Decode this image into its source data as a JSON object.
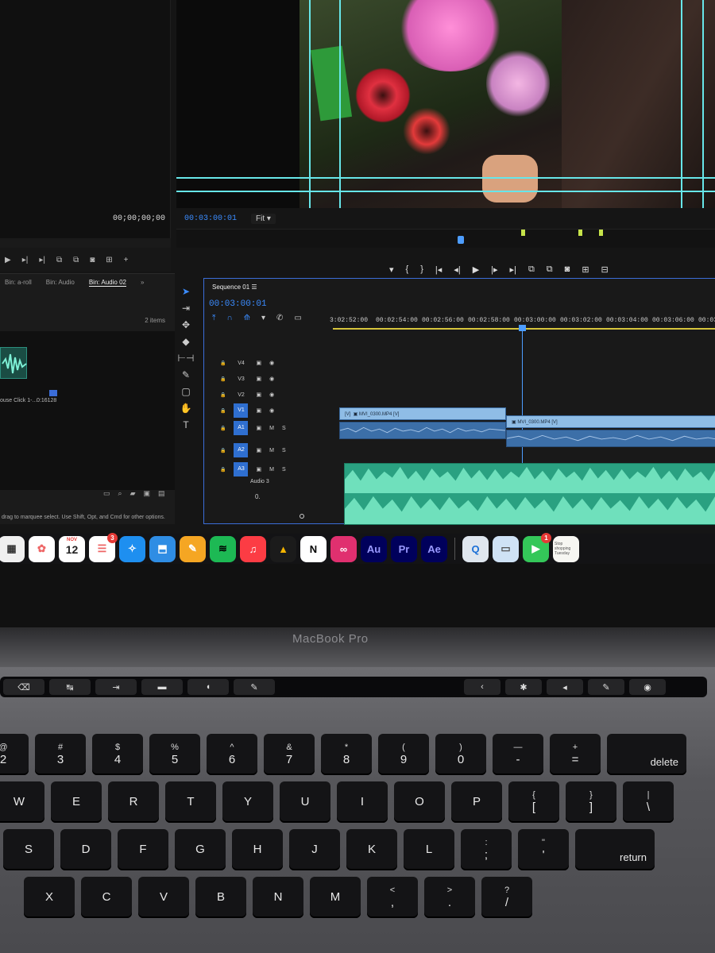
{
  "source_monitor": {
    "timecode": "00;00;00;00"
  },
  "program_monitor": {
    "timecode": "00:03:00:01",
    "fit": "Fit"
  },
  "program_controls": [
    "▾",
    "{",
    "}",
    "|◂",
    "◂|",
    "▶",
    "|▸",
    "▸|",
    "⧉",
    "⧉",
    "◙",
    "⊞",
    "⊟"
  ],
  "project": {
    "tabs": [
      "Bin: a-roll",
      "Bin: Audio",
      "Bin: Audio 02"
    ],
    "items_count": "2 items",
    "clip_name": "ouse Click 1-...",
    "clip_duration": "0:16128"
  },
  "status_text": "drag to marquee select. Use Shift, Opt, and Cmd for other options.",
  "timeline": {
    "tab": "Sequence 01",
    "timecode": "00:03:00:01",
    "ruler": [
      "3:02:52:00",
      "00:02:54:00",
      "00:02:56:00",
      "00:02:58:00",
      "00:03:00:00",
      "00:03:02:00",
      "00:03:04:00",
      "00:03:06:00",
      "00:03:0"
    ],
    "tracks": [
      {
        "label": "V4",
        "on": false
      },
      {
        "label": "V3",
        "on": false
      },
      {
        "label": "V2",
        "on": false
      },
      {
        "label": "V1",
        "on": true
      },
      {
        "label": "A1",
        "on": true,
        "audio": true
      },
      {
        "label": "A2",
        "on": true,
        "audio": true
      },
      {
        "label": "A3",
        "on": true,
        "audio": true
      }
    ],
    "audio3_name": "Audio 3",
    "audio3_level": "0.",
    "clip_fx": "[V]",
    "clip1": "MVI_0300.MP4 [V]",
    "clip2": "MVI_0300.MP4 [V]"
  },
  "dock": {
    "calendar_month": "NOV",
    "calendar_date": "12",
    "reminders_badge": "3",
    "facetime_badge": "1",
    "apps": [
      {
        "name": "Launchpad",
        "text": "▦",
        "bg": "#f0f0f0",
        "fg": "#333"
      },
      {
        "name": "Photos",
        "text": "✿",
        "bg": "#ffffff",
        "fg": "#e66"
      },
      {
        "name": "Calendar",
        "text": "",
        "bg": "#ffffff",
        "fg": "#222"
      },
      {
        "name": "Reminders",
        "text": "☰",
        "bg": "#ffffff",
        "fg": "#e66"
      },
      {
        "name": "Safari",
        "text": "✧",
        "bg": "#1e8ff0",
        "fg": "#fff"
      },
      {
        "name": "Keynote",
        "text": "⬒",
        "bg": "#2f8de4",
        "fg": "#fff"
      },
      {
        "name": "Pages",
        "text": "✎",
        "bg": "#f5a623",
        "fg": "#fff"
      },
      {
        "name": "Spotify",
        "text": "≋",
        "bg": "#1db954",
        "fg": "#000"
      },
      {
        "name": "Music",
        "text": "♫",
        "bg": "#fc3c44",
        "fg": "#fff"
      },
      {
        "name": "Google Drive",
        "text": "▲",
        "bg": "#1b1b1b",
        "fg": "#f4b400"
      },
      {
        "name": "Notion",
        "text": "N",
        "bg": "#ffffff",
        "fg": "#000"
      },
      {
        "name": "Creative Cloud",
        "text": "∞",
        "bg": "#e0306f",
        "fg": "#fff"
      },
      {
        "name": "Audition",
        "text": "Au",
        "bg": "#00005b",
        "fg": "#9999ff"
      },
      {
        "name": "Premiere Pro",
        "text": "Pr",
        "bg": "#00005b",
        "fg": "#9999ff"
      },
      {
        "name": "After Effects",
        "text": "Ae",
        "bg": "#00005b",
        "fg": "#9999ff"
      }
    ],
    "right_apps": [
      {
        "name": "QuickTime",
        "text": "Q",
        "bg": "#dfe6ee",
        "fg": "#1a6fd6"
      },
      {
        "name": "Preview",
        "text": "▭",
        "bg": "#cfe2f5",
        "fg": "#555"
      },
      {
        "name": "FaceTime",
        "text": "▶",
        "bg": "#34c759",
        "fg": "#fff"
      },
      {
        "name": "Stickies",
        "text": "",
        "bg": "#f7f7f2",
        "fg": "#555"
      }
    ],
    "stickies_text": "Stop shopping Tuesday"
  },
  "laptop": {
    "model": "MacBook Pro",
    "touchbar": [
      "⌫",
      "↹",
      "⇥",
      "▬",
      "◖",
      "✎",
      "",
      "",
      "",
      "",
      "‹",
      "✱",
      "◂",
      "✎",
      "◉"
    ],
    "rows": [
      [
        [
          "@",
          "2"
        ],
        [
          "#",
          "3"
        ],
        [
          "$",
          "4"
        ],
        [
          "%",
          "5"
        ],
        [
          "^",
          "6"
        ],
        [
          "&",
          "7"
        ],
        [
          "*",
          "8"
        ],
        [
          "(",
          "9"
        ],
        [
          ")",
          "0"
        ],
        [
          "—",
          "-"
        ],
        [
          "+",
          "="
        ],
        [
          "",
          "delete"
        ]
      ],
      [
        [
          "",
          "W"
        ],
        [
          "",
          "E"
        ],
        [
          "",
          "R"
        ],
        [
          "",
          "T"
        ],
        [
          "",
          "Y"
        ],
        [
          "",
          "U"
        ],
        [
          "",
          "I"
        ],
        [
          "",
          "O"
        ],
        [
          "",
          "P"
        ],
        [
          "{",
          "["
        ],
        [
          "}",
          "]"
        ],
        [
          "|",
          "\\"
        ]
      ],
      [
        [
          "",
          "S"
        ],
        [
          "",
          "D"
        ],
        [
          "",
          "F"
        ],
        [
          "",
          "G"
        ],
        [
          "",
          "H"
        ],
        [
          "",
          "J"
        ],
        [
          "",
          "K"
        ],
        [
          "",
          "L"
        ],
        [
          ":",
          ";"
        ],
        [
          "\"",
          "'"
        ],
        [
          "",
          "return"
        ]
      ],
      [
        [
          "",
          "X"
        ],
        [
          "",
          "C"
        ],
        [
          "",
          "V"
        ],
        [
          "",
          "B"
        ],
        [
          "",
          "N"
        ],
        [
          "",
          "M"
        ],
        [
          "<",
          ","
        ],
        [
          ">",
          "."
        ],
        [
          "?",
          "/"
        ]
      ]
    ]
  }
}
